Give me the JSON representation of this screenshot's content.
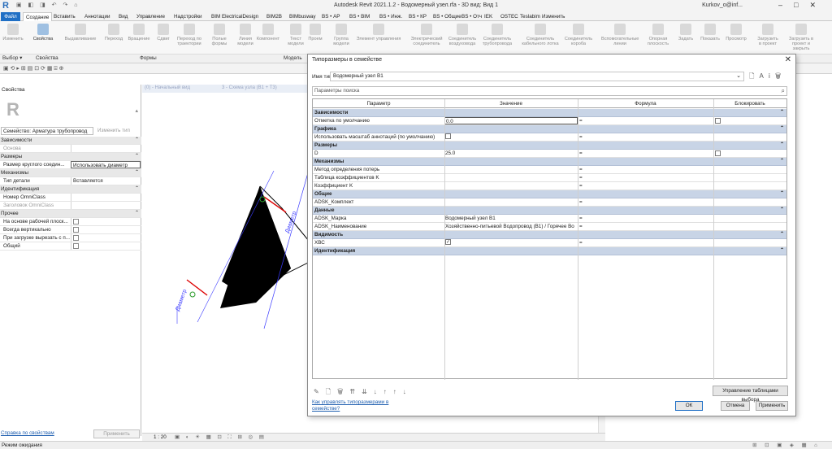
{
  "app": {
    "title": "Autodesk Revit 2021.1.2 - Водомерный узел.rfa - 3D вид: Вид 1",
    "user": "Kurkov_o@inf...",
    "logo": "R"
  },
  "ribbon_tabs": [
    "Файл",
    "Создание",
    "Вставить",
    "Аннотации",
    "Вид",
    "Управление",
    "Надстройки",
    "BIM ElectricalDesign",
    "BIM2B",
    "BIMbusway",
    "BS • АР",
    "BS • BIM",
    "BS • Инж.",
    "BS • КР",
    "BS • Общие",
    "BS • Отч",
    "IEK",
    "OSTEC",
    "Teslabim",
    "Изменить"
  ],
  "ribbon_buttons": [
    "Изменить",
    "Свойства",
    "Выдавливание",
    "Переход",
    "Вращение",
    "Сдвиг",
    "Переход по траектории",
    "Полые формы",
    "Линия модели",
    "Компонент",
    "Текст модели",
    "Проем",
    "Группа модели",
    "Элемент управления",
    "Электрический соединитель",
    "Соединитель воздуховода",
    "Соединитель трубопровода",
    "Соединитель кабельного лотка",
    "Соединитель короба",
    "Вспомогательные линии",
    "Опорная плоскость",
    "Задать",
    "Показать",
    "Просмотр",
    "Загрузить в проект",
    "Загрузить в проект и закрыть"
  ],
  "ribbon_panels": [
    "Выбор ▾",
    "Свойства",
    "Формы",
    "Модель"
  ],
  "properties": {
    "title": "Свойства",
    "family_label": "Семейство: Арматура трубопровод",
    "edit_type": "Изменить тип",
    "rows": [
      {
        "k": "Зависимости",
        "group": true
      },
      {
        "k": "Основа",
        "v": "",
        "gray": true
      },
      {
        "k": "Размеры",
        "group": true
      },
      {
        "k": "Размер круглого соедин...",
        "v": "Использовать диаметр"
      },
      {
        "k": "Механизмы",
        "group": true
      },
      {
        "k": "Тип детали",
        "v": "Вставляется"
      },
      {
        "k": "Идентификация",
        "group": true
      },
      {
        "k": "Номер OmniClass",
        "v": ""
      },
      {
        "k": "Заголовок OmniClass",
        "v": "",
        "gray": true
      },
      {
        "k": "Прочее",
        "group": true
      },
      {
        "k": "На основе рабочей плоск...",
        "cb": true
      },
      {
        "k": "Всегда вертикально",
        "cb": true
      },
      {
        "k": "При загрузке вырезать с п...",
        "cb": true
      },
      {
        "k": "Общий",
        "cb": true
      }
    ],
    "help_link": "Справка по свойствам",
    "apply": "Применить"
  },
  "view_tabs": [
    "(0) - Начальный вид",
    "3 - Схема узла (В1 + Т3)"
  ],
  "canvas": {
    "dim_label_1": "Диаметр",
    "dim_label_2": "Диаметр"
  },
  "view_scale": "1 : 20",
  "status": "Режим ожидания",
  "dialog": {
    "title": "Типоразмеры в семействе",
    "type_name_label": "Имя типа:",
    "type_name_value": "Водомерный узел В1",
    "search_placeholder": "Параметры поиска",
    "columns": [
      "Параметр",
      "Значение",
      "Формула",
      "Блокировать"
    ],
    "rows": [
      {
        "group": "Зависимости"
      },
      {
        "p": "Отметка по умолчанию",
        "v": "0.0",
        "f": "=",
        "lock": true,
        "edit": true
      },
      {
        "group": "Графика"
      },
      {
        "p": "Использовать масштаб аннотаций (по умолчанию)",
        "vcb": true,
        "f": "="
      },
      {
        "group": "Размеры"
      },
      {
        "p": "D",
        "v": "25.0",
        "f": "=",
        "lock": true
      },
      {
        "group": "Механизмы"
      },
      {
        "p": "Метод определения потерь",
        "v": "",
        "f": "="
      },
      {
        "p": "Таблица коэффициентов K",
        "v": "",
        "f": "="
      },
      {
        "p": "Коэффициент K",
        "v": "",
        "f": "="
      },
      {
        "group": "Общие"
      },
      {
        "p": "ADSK_Комплект",
        "v": "",
        "f": "="
      },
      {
        "group": "Данные"
      },
      {
        "p": "ADSK_Марка",
        "v": "Водомерный узел В1",
        "f": "="
      },
      {
        "p": "ADSK_Наименование",
        "v": "Хозяйственно-питьевой Водопровод (В1) / Горячее Во",
        "f": "="
      },
      {
        "group": "Видимость"
      },
      {
        "p": "ХВС",
        "vcb": true,
        "checked": true,
        "f": "="
      },
      {
        "group": "Идентификация"
      }
    ],
    "manage_lookup": "Управление таблицами выбора",
    "how_link": "Как управлять типоразмерами в семействе?",
    "ok": "ОК",
    "cancel": "Отмена",
    "apply": "Применить"
  }
}
